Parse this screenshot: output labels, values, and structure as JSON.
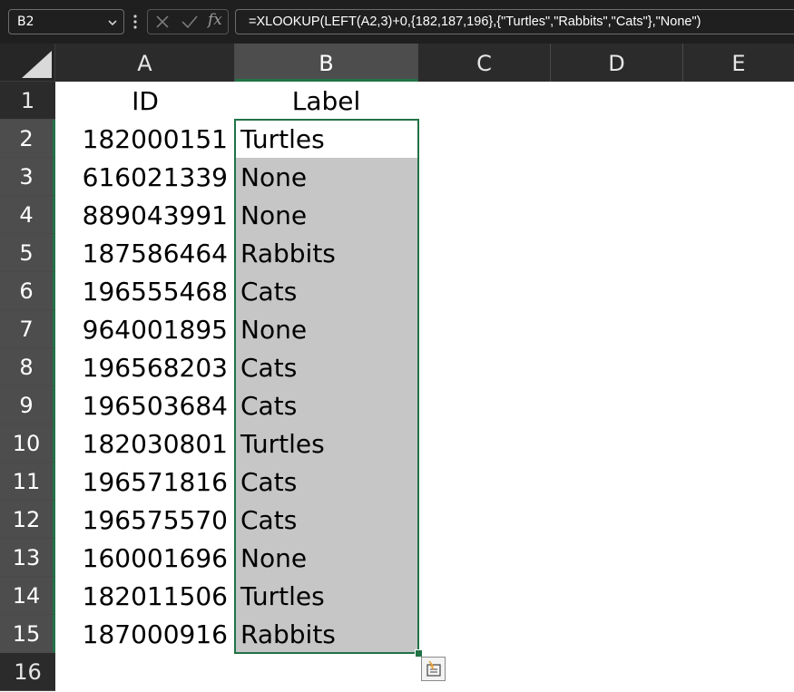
{
  "formula_bar": {
    "name_box": "B2",
    "fx_label": "fx",
    "formula": "=XLOOKUP(LEFT(A2,3)+0,{182,187,196},{\"Turtles\",\"Rabbits\",\"Cats\"},\"None\")"
  },
  "columns": [
    "A",
    "B",
    "C",
    "D",
    "E"
  ],
  "rows": [
    "1",
    "2",
    "3",
    "4",
    "5",
    "6",
    "7",
    "8",
    "9",
    "10",
    "11",
    "12",
    "13",
    "14",
    "15",
    "16"
  ],
  "sheet": {
    "header": {
      "id": "ID",
      "label": "Label"
    },
    "data": [
      {
        "id": "182000151",
        "label": "Turtles"
      },
      {
        "id": "616021339",
        "label": "None"
      },
      {
        "id": "889043991",
        "label": "None"
      },
      {
        "id": "187586464",
        "label": "Rabbits"
      },
      {
        "id": "196555468",
        "label": "Cats"
      },
      {
        "id": "964001895",
        "label": "None"
      },
      {
        "id": "196568203",
        "label": "Cats"
      },
      {
        "id": "196503684",
        "label": "Cats"
      },
      {
        "id": "182030801",
        "label": "Turtles"
      },
      {
        "id": "196571816",
        "label": "Cats"
      },
      {
        "id": "196575570",
        "label": "Cats"
      },
      {
        "id": "160001696",
        "label": "None"
      },
      {
        "id": "182011506",
        "label": "Turtles"
      },
      {
        "id": "187000916",
        "label": "Rabbits"
      }
    ]
  },
  "selection": {
    "active_cell": "B2",
    "range": "B2:B15"
  },
  "icons": {
    "name_box_dropdown": "chevron-down-icon",
    "cancel": "close-icon",
    "enter": "check-icon",
    "insert_function": "fx-icon",
    "quick_analysis": "quick-analysis-icon"
  },
  "colors": {
    "accent": "#217346",
    "selection_fill": "#c6c6c6",
    "header_bg": "#2b2b2b"
  }
}
